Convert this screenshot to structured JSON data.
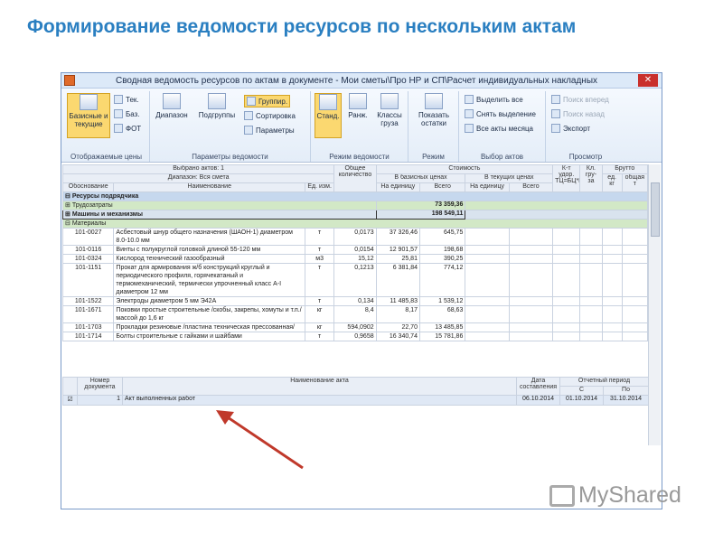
{
  "slide_title": "Формирование ведомости ресурсов по нескольким актам",
  "window": {
    "title": "Сводная ведомость ресурсов по актам в документе - Мои сметы\\Про НР и СП\\Расчет индивидуальных накладных",
    "close": "✕"
  },
  "ribbon": {
    "groups": {
      "prices": "Отображаемые цены",
      "params": "Параметры ведомости",
      "mode": "Режим ведомости",
      "regime": "Режим",
      "acts": "Выбор актов",
      "view": "Просмотр"
    },
    "basic_current": "Базисные и текущие",
    "tek": "Тек.",
    "baz": "Баз.",
    "fot": "ФОТ",
    "range": "Диапазон",
    "subgroups": "Подгруппы",
    "group": "Группир.",
    "sort": "Сортировка",
    "params": "Параметры",
    "std": "Станд.",
    "rank": "Ранж.",
    "classes": "Классы груза",
    "show_rest": "Показать остатки",
    "select_all": "Выделить все",
    "deselect": "Снять выделение",
    "all_month": "Все акты месяца",
    "search_fwd": "Поиск вперед",
    "search_back": "Поиск назад",
    "export": "Экспорт"
  },
  "grid": {
    "selected": "Выбрано актов: 1",
    "range": "Диапазон: Вся смета",
    "headers": {
      "obosn": "Обоснование",
      "name": "Наименование",
      "unit": "Ед. изм.",
      "total_qty": "Общее количество",
      "cost": "Стоимость",
      "base_prices": "В базисных ценах",
      "cur_prices": "В текущих ценах",
      "per_unit": "На единицу",
      "total": "Всего",
      "kt": "К-т удор. ТЦ=БЦ*К",
      "kl": "Кл. гру- за",
      "brutto": "Брутто",
      "ed_kg": "ед. кг",
      "total_kg": "общая т"
    },
    "group_main": "Ресурсы подрядчика",
    "labor": "Трудозатраты",
    "labor_total": "73 359,36",
    "machines": "Машины и механизмы",
    "machines_total": "198 549,11",
    "materials": "Материалы",
    "rows": [
      {
        "code": "101-0027",
        "name": "Асбестовый шнур общего назначения (ШАОН-1) диаметром 8.0-10.0 мм",
        "unit": "т",
        "qty": "0,0173",
        "unit_price": "37 326,46",
        "total": "645,75"
      },
      {
        "code": "101-0116",
        "name": "Винты с полукруглой головкой длиной 55-120 мм",
        "unit": "т",
        "qty": "0,0154",
        "unit_price": "12 901,57",
        "total": "198,68"
      },
      {
        "code": "101-0324",
        "name": "Кислород технический газообразный",
        "unit": "м3",
        "qty": "15,12",
        "unit_price": "25,81",
        "total": "390,25"
      },
      {
        "code": "101-1151",
        "name": "Прокат для армирования ж/б конструкций круглый и периодического профиля, горячекатаный и термомеханический, термически упрочненный класс А-I диаметром 12 мм",
        "unit": "т",
        "qty": "0,1213",
        "unit_price": "6 381,84",
        "total": "774,12"
      },
      {
        "code": "101-1522",
        "name": "Электроды диаметром 5 мм Э42А",
        "unit": "т",
        "qty": "0,134",
        "unit_price": "11 485,83",
        "total": "1 539,12"
      },
      {
        "code": "101-1671",
        "name": "Поковки простые строительные /скобы, закрепы, хомуты и т.п./ массой до 1,6 кг",
        "unit": "кг",
        "qty": "8,4",
        "unit_price": "8,17",
        "total": "68,63"
      },
      {
        "code": "101-1703",
        "name": "Прокладки резиновые /пластина техническая прессованная/",
        "unit": "кг",
        "qty": "594,0902",
        "unit_price": "22,70",
        "total": "13 485,85"
      },
      {
        "code": "101-1714",
        "name": "Болты строительные с гайками и шайбами",
        "unit": "т",
        "qty": "0,9658",
        "unit_price": "16 340,74",
        "total": "15 781,86"
      }
    ]
  },
  "acts": {
    "headers": {
      "num": "Номер документа",
      "name": "Наименование акта",
      "date": "Дата составления",
      "period": "Отчетный период",
      "from": "С",
      "to": "По"
    },
    "rows": [
      {
        "checked": "☑",
        "num": "1",
        "name": "Акт выполненных работ",
        "date": "06.10.2014",
        "from": "01.10.2014",
        "to": "31.10.2014"
      }
    ]
  },
  "watermark": "MyShared",
  "colors": {
    "title": "#2a7fc1",
    "arrow": "#c0392b",
    "selection": "#fbd870"
  }
}
